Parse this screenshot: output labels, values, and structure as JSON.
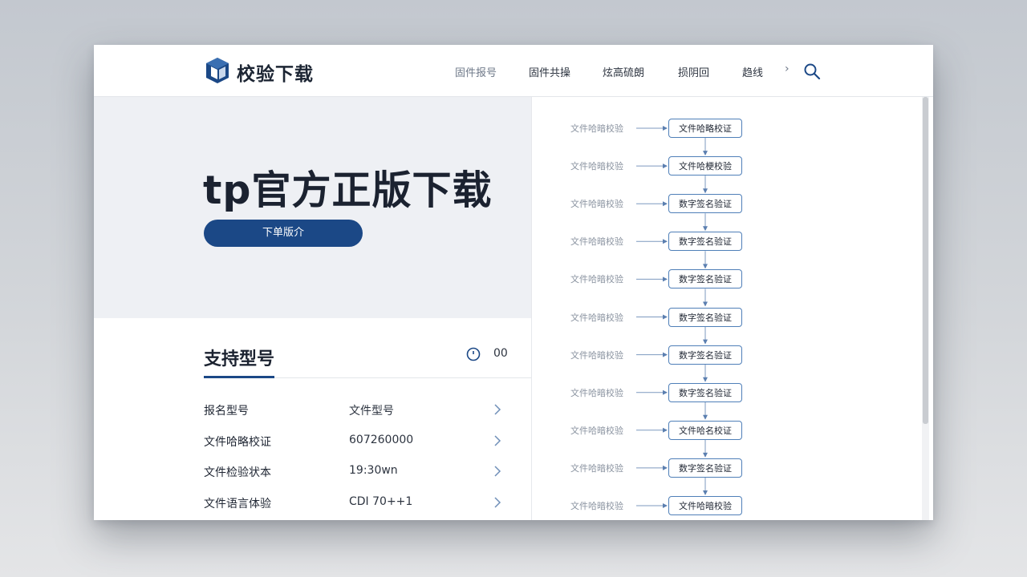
{
  "brand": {
    "name": "校验下载"
  },
  "nav": {
    "items": [
      {
        "label": "固件报号",
        "active": true
      },
      {
        "label": "固件共操",
        "active": false
      },
      {
        "label": "炫高硫朗",
        "active": false
      },
      {
        "label": "损阴回",
        "active": false
      },
      {
        "label": "趋线",
        "active": false
      }
    ],
    "more_icon": "chevron-right-icon",
    "search_icon": "search-icon"
  },
  "hero": {
    "title": "tp官方正版下载",
    "cta_label": "下单版介"
  },
  "models": {
    "title": "支持型号",
    "count": "00",
    "rows": [
      {
        "label": "报名型号",
        "value": "文件型号"
      },
      {
        "label": "文件哈略校证",
        "value": "607260000"
      },
      {
        "label": "文件检验状本",
        "value": "19:30wn"
      },
      {
        "label": "文件语言体验",
        "value": "CDI 70++1"
      }
    ]
  },
  "flow": {
    "steps": [
      {
        "left": "文件哈暗校验",
        "box": "文件哈略校证"
      },
      {
        "left": "文件哈暗校验",
        "box": "文件哈梗校验"
      },
      {
        "left": "文件哈暗校验",
        "box": "数字签名验证"
      },
      {
        "left": "文件哈暗校验",
        "box": "数字签名验证"
      },
      {
        "left": "文件哈暗校验",
        "box": "数字签名验证"
      },
      {
        "left": "文件哈暗校验",
        "box": "数字签名验证"
      },
      {
        "left": "文件哈暗校验",
        "box": "数字签名验证"
      },
      {
        "left": "文件哈暗校验",
        "box": "数字签名验证"
      },
      {
        "left": "文件哈暗校验",
        "box": "文件哈名校证"
      },
      {
        "left": "文件哈暗校验",
        "box": "数字签名验证"
      },
      {
        "left": "文件哈暗校验",
        "box": "文件哈暗校验"
      }
    ]
  },
  "colors": {
    "accent": "#1b4886",
    "box_border": "#4f7fb8",
    "hero_bg": "#eef0f4",
    "page_bg": "#d3d6da"
  }
}
